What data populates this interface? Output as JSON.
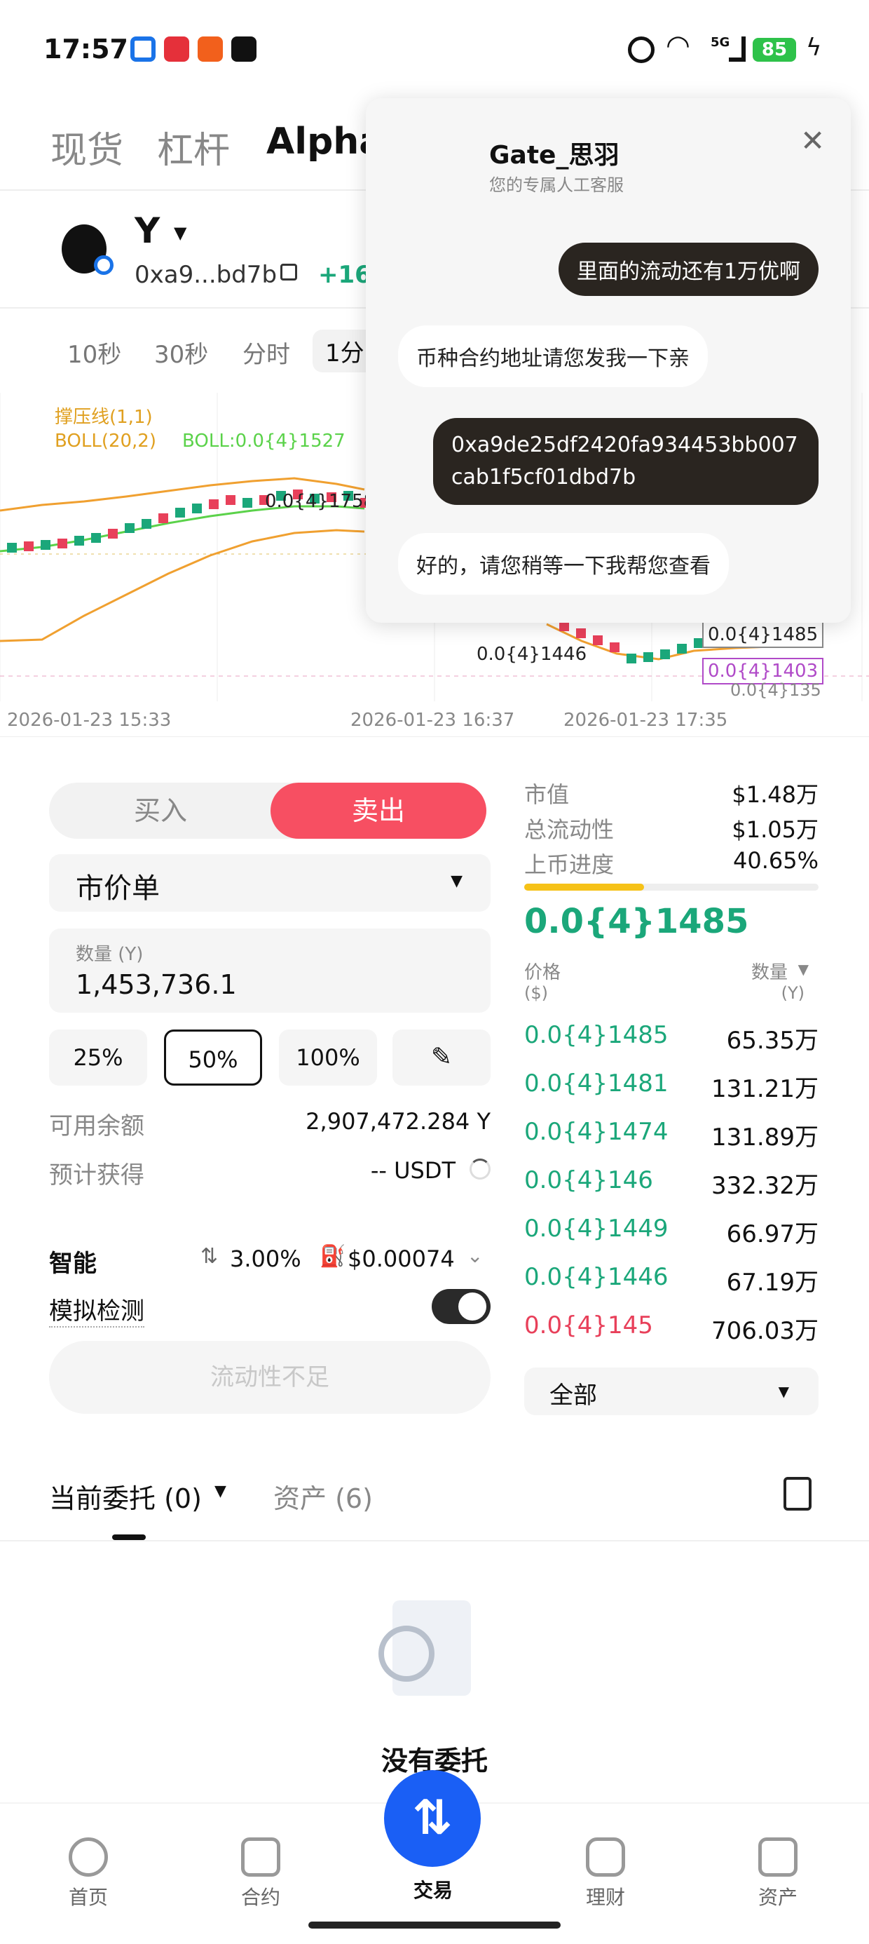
{
  "status_bar": {
    "time": "17:57",
    "battery": "85",
    "network": "5G"
  },
  "top_tabs": [
    "现货",
    "杠杆",
    "Alpha"
  ],
  "token": {
    "symbol": "Y",
    "address_short": "0xa9...bd7b",
    "change": "+16"
  },
  "timeframes": [
    "10秒",
    "30秒",
    "分时",
    "1分"
  ],
  "chart": {
    "indicator1": "撑压线(1,1)",
    "indicator2": "BOLL(20,2)",
    "indicator3": "BOLL:0.0{4}1527",
    "marker_high": "0.0{4}1758",
    "marker_low": "0.0{4}1446",
    "price_tag_current": "0.0{4}1485",
    "price_tag_purple": "0.0{4}1403",
    "price_tag_partial": "0.0{4}135",
    "x_labels": [
      "2026-01-23 15:33",
      "2026-01-23 16:37",
      "2026-01-23 17:35"
    ],
    "colors": {
      "up": "#1ba77a",
      "down": "#e8405a",
      "boll_upper": "#f0a030",
      "boll_mid": "#5bd24a"
    }
  },
  "order_form": {
    "buy_label": "买入",
    "sell_label": "卖出",
    "order_type": "市价单",
    "qty_label": "数量 (Y)",
    "qty_value": "1,453,736.1",
    "pct_buttons": [
      "25%",
      "50%",
      "100%"
    ],
    "available_label": "可用余额",
    "available_value": "2,907,472.284 Y",
    "estimate_label": "预计获得",
    "estimate_value": "-- USDT",
    "smart_label": "智能",
    "slippage": "3.00%",
    "fee": "$0.00074",
    "sim_label": "模拟检测",
    "submit_label": "流动性不足"
  },
  "stats": {
    "mcap_label": "市值",
    "mcap_value": "$1.48万",
    "liq_label": "总流动性",
    "liq_value": "$1.05万",
    "progress_label": "上币进度",
    "progress_value": "40.65%",
    "progress": 0.4065,
    "last_price": "0.0{4}1485"
  },
  "orderbook": {
    "price_header": "价格",
    "price_unit": "($)",
    "qty_header": "数量",
    "qty_unit": "(Y)",
    "rows": [
      {
        "price": "0.0{4}1485",
        "qty": "65.35万",
        "side": "buy"
      },
      {
        "price": "0.0{4}1481",
        "qty": "131.21万",
        "side": "buy"
      },
      {
        "price": "0.0{4}1474",
        "qty": "131.89万",
        "side": "buy"
      },
      {
        "price": "0.0{4}146",
        "qty": "332.32万",
        "side": "buy"
      },
      {
        "price": "0.0{4}1449",
        "qty": "66.97万",
        "side": "buy"
      },
      {
        "price": "0.0{4}1446",
        "qty": "67.19万",
        "side": "buy"
      },
      {
        "price": "0.0{4}145",
        "qty": "706.03万",
        "side": "sell"
      }
    ],
    "filter": "全部"
  },
  "bottom_tabs": {
    "current_orders": "当前委托 (0)",
    "assets": "资产 (6)"
  },
  "empty_state": "没有委托",
  "nav": [
    "首页",
    "合约",
    "交易",
    "理财",
    "资产"
  ],
  "chat": {
    "agent_name": "Gate_思羽",
    "agent_subtitle": "您的专属人工客服",
    "messages": [
      {
        "from": "user",
        "text": "里面的流动还有1万优啊"
      },
      {
        "from": "agent",
        "text": "币种合约地址请您发我一下亲"
      },
      {
        "from": "user",
        "text": "0xa9de25df2420fa934453bb007cab1f5cf01dbd7b"
      },
      {
        "from": "agent",
        "text": "好的，请您稍等一下我帮您查看"
      }
    ]
  }
}
